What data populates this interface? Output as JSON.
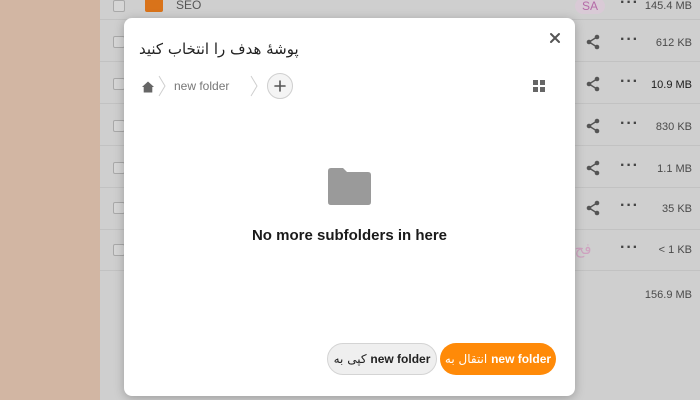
{
  "background": {
    "rows": [
      {
        "name": "SEO",
        "size": "145.4 MB",
        "badge": "SA",
        "share": false
      },
      {
        "name": "",
        "size": "612 KB",
        "badge": "",
        "share": true
      },
      {
        "name": "",
        "size": "10.9 MB",
        "badge": "",
        "share": true
      },
      {
        "name": "",
        "size": "830 KB",
        "badge": "",
        "share": true
      },
      {
        "name": "",
        "size": "1.1 MB",
        "badge": "",
        "share": true
      },
      {
        "name": "",
        "size": "35 KB",
        "badge": "",
        "share": true
      },
      {
        "name": "",
        "size": "< 1 KB",
        "badge": "فح",
        "share": false
      }
    ],
    "total_size": "156.9 MB",
    "colors": {
      "accent_thumb": "#d9731a"
    }
  },
  "modal": {
    "title": "پوشهٔ هدف را انتخاب کنید",
    "breadcrumb": {
      "folder": "new folder"
    },
    "empty_message": "No more subfolders in here",
    "copy_button": {
      "folder": "new folder",
      "prefix": "کپی به"
    },
    "move_button": {
      "folder": "new folder",
      "prefix": "انتقال به"
    },
    "icons": {
      "home": "home-icon",
      "add": "plus-icon",
      "grid": "grid-view-icon",
      "close": "close-icon",
      "folder": "folder-icon"
    },
    "colors": {
      "primary": "#ff8a08"
    }
  }
}
